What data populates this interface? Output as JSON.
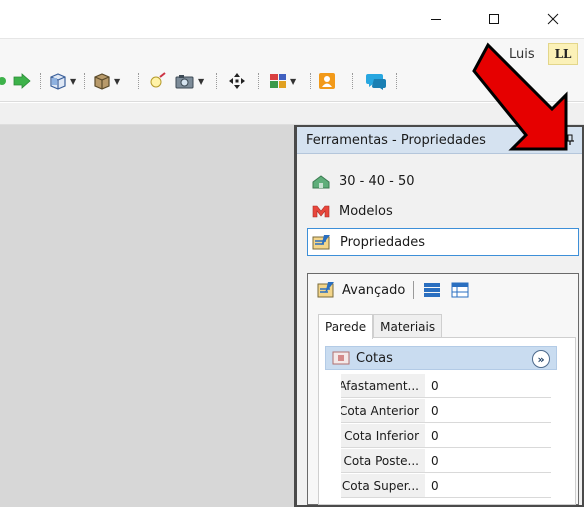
{
  "window": {
    "minimize_label": "—",
    "maximize_label": "☐",
    "close_label": "✕"
  },
  "user": {
    "name": "Luis",
    "initials": "LL"
  },
  "toolbar": {
    "icons": [
      "forward-icon",
      "box-view-icon",
      "box-3d-icon",
      "light-icon",
      "camera-icon",
      "move-icon",
      "layout-icon",
      "contact-icon",
      "chat-icon"
    ]
  },
  "panel": {
    "title": "Ferramentas - Propriedades",
    "pin_icon": "pin-icon",
    "nav": [
      {
        "label": "30 - 40 - 50",
        "icon": "house-icon"
      },
      {
        "label": "Modelos",
        "icon": "models-icon"
      },
      {
        "label": "Propriedades",
        "icon": "properties-icon"
      }
    ],
    "sub": {
      "advanced_label": "Avançado",
      "tabs": [
        "Parede",
        "Materiais"
      ],
      "group_title": "Cotas",
      "properties": [
        {
          "name": "Afastament...",
          "value": "0"
        },
        {
          "name": "Cota Anterior",
          "value": "0"
        },
        {
          "name": "Cota Inferior",
          "value": "0"
        },
        {
          "name": "Cota Poste...",
          "value": "0"
        },
        {
          "name": "Cota Super...",
          "value": "0"
        }
      ]
    }
  },
  "colors": {
    "panel_header": "#d5e2f0",
    "selection_border": "#3d8fd8",
    "arrow": "#e60000",
    "canvas": "#d7d7d7"
  }
}
